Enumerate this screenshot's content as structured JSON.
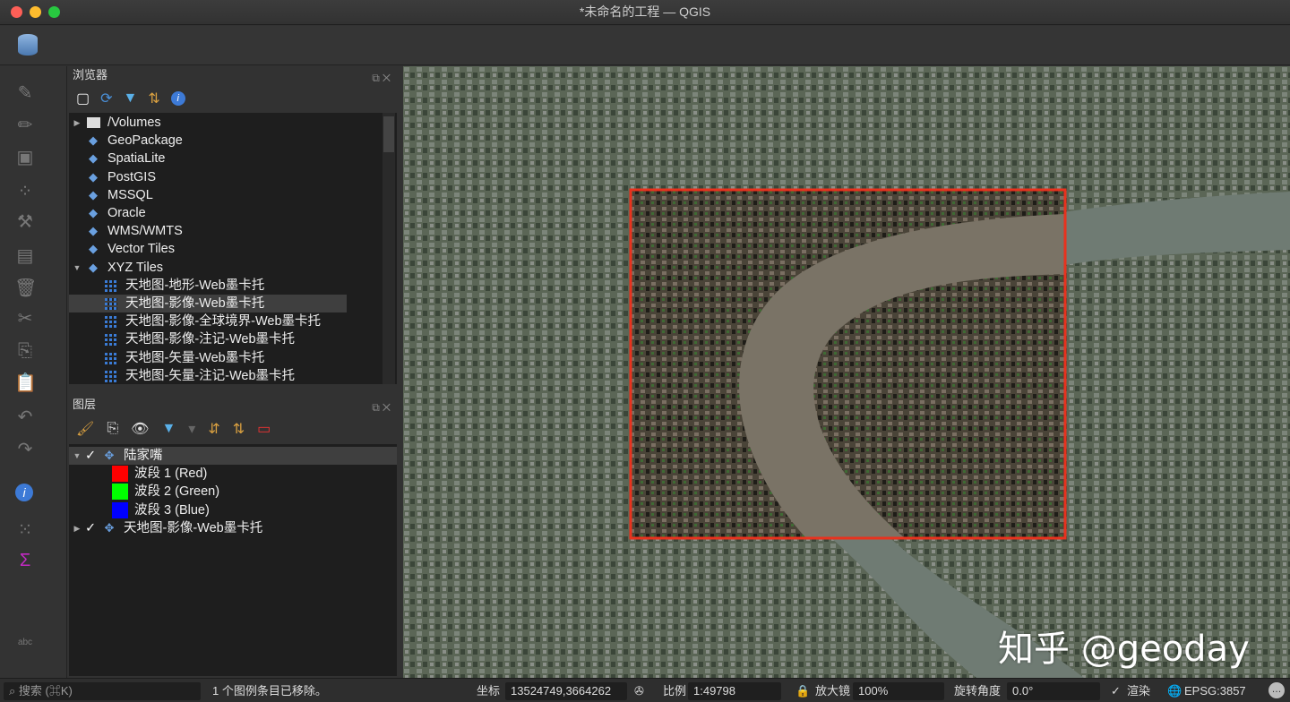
{
  "window": {
    "title": "*未命名的工程 — QGIS"
  },
  "browser": {
    "title": "浏览器",
    "items": [
      {
        "label": "/Volumes",
        "icon": "folder-icon",
        "expand": "▶"
      },
      {
        "label": "GeoPackage",
        "icon": "geopackage-icon"
      },
      {
        "label": "SpatiaLite",
        "icon": "spatialite-icon"
      },
      {
        "label": "PostGIS",
        "icon": "postgis-icon"
      },
      {
        "label": "MSSQL",
        "icon": "mssql-icon"
      },
      {
        "label": "Oracle",
        "icon": "oracle-icon"
      },
      {
        "label": "WMS/WMTS",
        "icon": "wms-icon"
      },
      {
        "label": "Vector Tiles",
        "icon": "vector-tiles-icon"
      },
      {
        "label": "XYZ Tiles",
        "icon": "xyz-icon",
        "expand": "▼"
      }
    ],
    "xyz_children": [
      "天地图-地形-Web墨卡托",
      "天地图-影像-Web墨卡托",
      "天地图-影像-全球境界-Web墨卡托",
      "天地图-影像-注记-Web墨卡托",
      "天地图-矢量-Web墨卡托",
      "天地图-矢量-注记-Web墨卡托"
    ]
  },
  "layers": {
    "title": "图层",
    "group": "陆家嘴",
    "bands": [
      {
        "label": "波段 1 (Red)",
        "color": "#ff0000"
      },
      {
        "label": "波段 2 (Green)",
        "color": "#00ff00"
      },
      {
        "label": "波段 3 (Blue)",
        "color": "#0000ff"
      }
    ],
    "layer2": "天地图-影像-Web墨卡托"
  },
  "map": {
    "watermark": "知乎 @geoday",
    "extent_color": "#e8321e"
  },
  "status": {
    "search_placeholder": "搜索 (⌘K)",
    "message": "1 个图例条目已移除。",
    "coord_label": "坐标",
    "coord": "13524749,3664262",
    "scale_label": "比例",
    "scale": "1:49798",
    "magnifier_label": "放大镜",
    "magnifier": "100%",
    "rotation_label": "旋转角度",
    "rotation": "0.0°",
    "render_label": "渲染",
    "crs": "EPSG:3857"
  }
}
